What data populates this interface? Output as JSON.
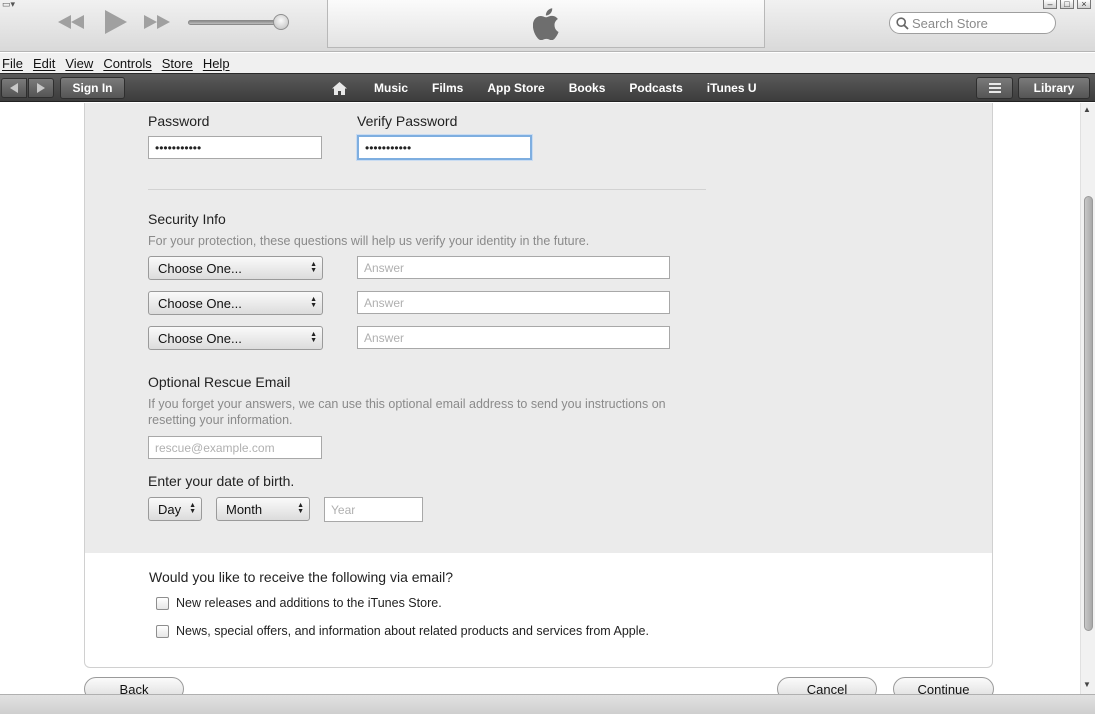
{
  "toolbar": {
    "search_placeholder": "Search Store"
  },
  "menubar": {
    "items": [
      "File",
      "Edit",
      "View",
      "Controls",
      "Store",
      "Help"
    ]
  },
  "nav": {
    "sign_in": "Sign In",
    "links": [
      "Music",
      "Films",
      "App Store",
      "Books",
      "Podcasts",
      "iTunes U"
    ],
    "library": "Library"
  },
  "form": {
    "password_label": "Password",
    "password_value": "•••••••••••",
    "verify_label": "Verify Password",
    "verify_value": "•••••••••••",
    "security_title": "Security Info",
    "security_desc": "For your protection, these questions will help us verify your identity in the future.",
    "question_select": "Choose One...",
    "answer_placeholder": "Answer",
    "rescue_title": "Optional Rescue Email",
    "rescue_desc": "If you forget your answers, we can use this optional email address to send you instructions on resetting your information.",
    "rescue_placeholder": "rescue@example.com",
    "dob_title": "Enter your date of birth.",
    "day_select": "Day",
    "month_select": "Month",
    "year_placeholder": "Year"
  },
  "email_prefs": {
    "title": "Would you like to receive the following via email?",
    "option1": "New releases and additions to the iTunes Store.",
    "option2": "News, special offers, and information about related products and services from Apple."
  },
  "footer": {
    "back": "Back",
    "cancel": "Cancel",
    "continue": "Continue"
  }
}
